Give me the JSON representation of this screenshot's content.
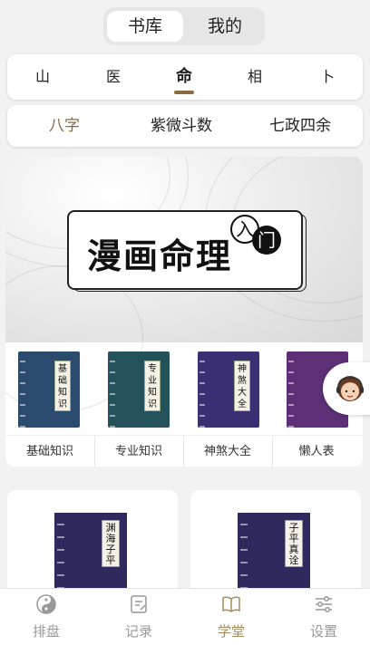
{
  "switch": {
    "items": [
      "书库",
      "我的"
    ],
    "active": "书库"
  },
  "categories": {
    "items": [
      "山",
      "医",
      "命",
      "相",
      "卜"
    ],
    "active": "命"
  },
  "subtabs": {
    "items": [
      "八字",
      "紫微斗数",
      "七政四余"
    ],
    "active": "八字"
  },
  "banner": {
    "title": "漫画命理",
    "seal_char_1": "入",
    "seal_char_2": "门"
  },
  "books": [
    {
      "name": "基础知识",
      "cover_text": "基础知识",
      "color": "#2a4b6e"
    },
    {
      "name": "专业知识",
      "cover_text": "专业知识",
      "color": "#24525a"
    },
    {
      "name": "神煞大全",
      "cover_text": "神煞大全",
      "color": "#3b2f74"
    },
    {
      "name": "懒人表",
      "cover_text": "",
      "color": "#5c2f76"
    }
  ],
  "cards": [
    {
      "cover_text": "渊海子平"
    },
    {
      "cover_text": "子平真诠"
    }
  ],
  "nav": {
    "items": [
      {
        "label": "排盘",
        "icon": "yin-yang-icon"
      },
      {
        "label": "记录",
        "icon": "record-icon"
      },
      {
        "label": "学堂",
        "icon": "book-open-icon"
      },
      {
        "label": "设置",
        "icon": "sliders-icon"
      }
    ],
    "active": "学堂"
  },
  "colors": {
    "accent": "#8b6a3e",
    "nav_active": "#a58a5e",
    "background": "#f2f2f2"
  }
}
